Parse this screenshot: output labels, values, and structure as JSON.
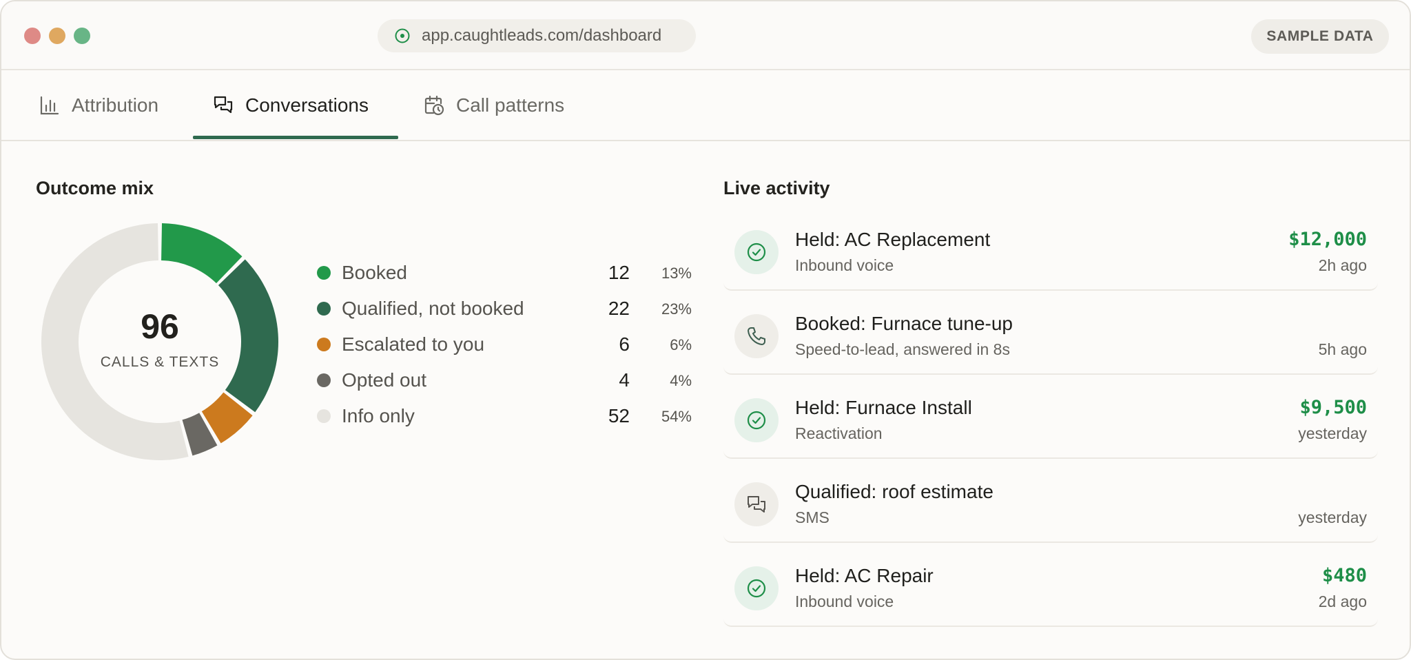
{
  "browser": {
    "url": "app.caughtleads.com/dashboard",
    "badge": "SAMPLE DATA"
  },
  "tabs": [
    {
      "label": "Attribution",
      "icon": "bar-chart-icon",
      "active": false
    },
    {
      "label": "Conversations",
      "icon": "chat-bubbles-icon",
      "active": true
    },
    {
      "label": "Call patterns",
      "icon": "calendar-clock-icon",
      "active": false
    }
  ],
  "outcome": {
    "title": "Outcome mix",
    "total": "96",
    "total_label": "CALLS & TEXTS"
  },
  "chart_data": {
    "type": "pie",
    "title": "Outcome mix",
    "categories": [
      "Booked",
      "Qualified, not booked",
      "Escalated to you",
      "Opted out",
      "Info only"
    ],
    "values": [
      12,
      22,
      6,
      4,
      52
    ],
    "percents": [
      "13%",
      "23%",
      "6%",
      "4%",
      "54%"
    ],
    "colors": [
      "#22994a",
      "#2f6a4f",
      "#cc7a1e",
      "#6a6863",
      "#e6e4df"
    ],
    "center_value": "96",
    "center_label": "CALLS & TEXTS",
    "legend": "right"
  },
  "activity": {
    "title": "Live activity",
    "items": [
      {
        "title": "Held: AC Replacement",
        "subtitle": "Inbound voice",
        "amount": "$12,000",
        "time": "2h ago",
        "icon": "check-circle-icon"
      },
      {
        "title": "Booked: Furnace tune-up",
        "subtitle": "Speed-to-lead, answered in 8s",
        "amount": "",
        "time": "5h ago",
        "icon": "phone-icon"
      },
      {
        "title": "Held: Furnace Install",
        "subtitle": "Reactivation",
        "amount": "$9,500",
        "time": "yesterday",
        "icon": "check-circle-icon"
      },
      {
        "title": "Qualified: roof estimate",
        "subtitle": "SMS",
        "amount": "",
        "time": "yesterday",
        "icon": "chat-bubbles-icon"
      },
      {
        "title": "Held: AC Repair",
        "subtitle": "Inbound voice",
        "amount": "$480",
        "time": "2d ago",
        "icon": "check-circle-icon"
      }
    ]
  },
  "colors": {
    "accent_green": "#1e8e48",
    "tab_underline": "#2f6a4f"
  }
}
